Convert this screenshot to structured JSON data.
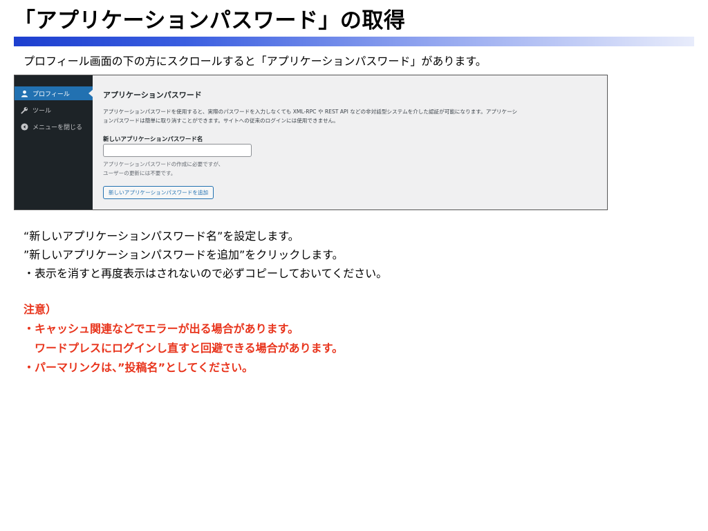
{
  "slide": {
    "title": "「アプリケーションパスワード」の取得",
    "intro": "プロフィール画面の下の方にスクロールすると「アプリケーションパスワード」があります。"
  },
  "screenshot": {
    "sidebar": {
      "items": [
        {
          "label": "プロフィール",
          "icon": "user-icon",
          "active": true
        },
        {
          "label": "ツール",
          "icon": "wrench-icon",
          "active": false
        },
        {
          "label": "メニューを閉じる",
          "icon": "collapse-arrow-icon",
          "active": false
        }
      ]
    },
    "section": {
      "heading": "アプリケーションパスワード",
      "description_line1": "アプリケーションパスワードを使用すると、実際のパスワードを入力しなくても XML-RPC や REST API などの非対話型システムを介した認証が可能になります。アプリケーシ",
      "description_line2": "ョンパスワードは簡単に取り消すことができます。サイトへの従来のログインには使用できません。",
      "field_label": "新しいアプリケーションパスワード名",
      "field_value": "",
      "help_line1": "アプリケーションパスワードの作成に必要ですが、",
      "help_line2": "ユーザーの更新には不要です。",
      "add_button": "新しいアプリケーションパスワードを追加"
    },
    "colors": {
      "sidebar_bg": "#1d2327",
      "active_item": "#2271b1",
      "content_bg": "#f0f0f1"
    }
  },
  "notes": [
    "“新しいアプリケーションパスワード名”を設定します。",
    "”新しいアプリケーションパスワードを追加”をクリックします。",
    "・表示を消すと再度表示はされないので必ずコピーしておいてください。"
  ],
  "warning": {
    "heading": "注意）",
    "lines": [
      "・キャッシュ関連などでエラーが出る場合があります。",
      "　ワードプレスにログインし直すと回避できる場合があります。",
      "・パーマリンクは、”投稿名”としてください。"
    ],
    "color": "#e8341c"
  }
}
